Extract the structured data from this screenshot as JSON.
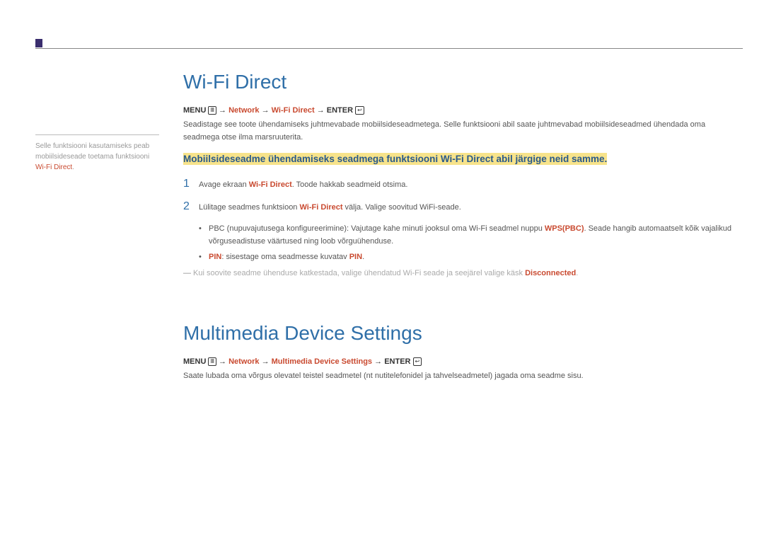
{
  "sideNote": {
    "line1": "Selle funktsiooni kasutamiseks peab mobiilsideseade toetama funktsiooni ",
    "red": "Wi-Fi Direct",
    "tail": "."
  },
  "section1": {
    "title": "Wi-Fi Direct",
    "menu": {
      "label": "MENU",
      "icon": "Ⅲ",
      "arrow": "→",
      "p1": "Network",
      "p2": "Wi-Fi Direct",
      "enterLabel": "ENTER",
      "enterIcon": "↩"
    },
    "intro": "Seadistage see toote ühendamiseks juhtmevabade mobiilsideseadmetega. Selle funktsiooni abil saate juhtmevabad mobiilsideseadmed ühendada oma seadmega otse ilma marsruuterita.",
    "highlight": "Mobiilsideseadme ühendamiseks seadmega funktsiooni Wi-Fi Direct abil järgige neid samme.",
    "step1": {
      "num": "1",
      "pre": "Avage ekraan ",
      "red": "Wi-Fi Direct",
      "post": ". Toode hakkab seadmeid otsima."
    },
    "step2": {
      "num": "2",
      "pre": "Lülitage seadmes funktsioon ",
      "red": "Wi-Fi Direct",
      "post": " välja. Valige soovitud WiFi-seade."
    },
    "sub1": {
      "pre": "PBC (nupuvajutusega konfigureerimine): Vajutage kahe minuti jooksul oma Wi-Fi seadmel nuppu ",
      "red": "WPS(PBC)",
      "post": ". Seade hangib automaatselt kõik vajalikud võrguseadistuse väärtused ning loob võrguühenduse."
    },
    "sub2": {
      "red1": "PIN",
      "mid": ": sisestage oma seadmesse kuvatav ",
      "red2": "PIN",
      "tail": "."
    },
    "footnote": {
      "dash": "―",
      "pre": " Kui soovite seadme ühenduse katkestada, valige ühendatud Wi-Fi seade ja seejärel valige käsk ",
      "red": "Disconnected",
      "tail": "."
    }
  },
  "section2": {
    "title": "Multimedia Device Settings",
    "menu": {
      "label": "MENU",
      "icon": "Ⅲ",
      "arrow": "→",
      "p1": "Network",
      "p2": "Multimedia Device Settings",
      "enterLabel": "ENTER",
      "enterIcon": "↩"
    },
    "body": "Saate lubada oma võrgus olevatel teistel seadmetel (nt nutitelefonidel ja tahvelseadmetel) jagada oma seadme sisu."
  }
}
